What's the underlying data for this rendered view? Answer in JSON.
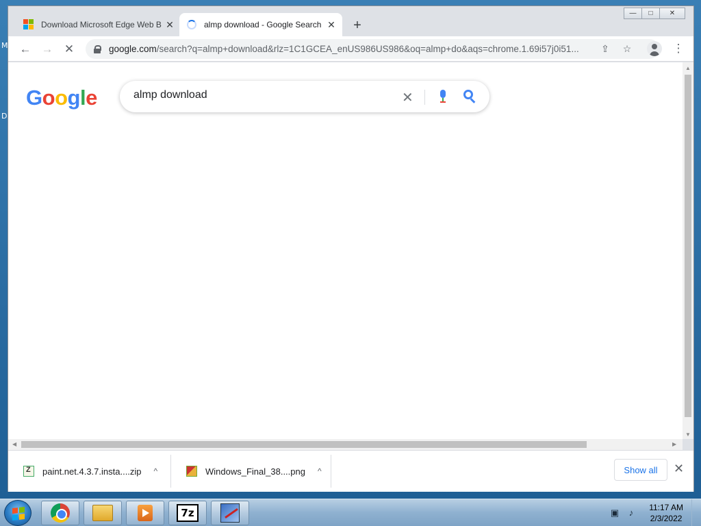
{
  "desktop": {
    "edge_letters": [
      "M",
      "D"
    ]
  },
  "window": {
    "controls": {
      "minimize": "—",
      "maximize": "□",
      "close": "✕"
    }
  },
  "tabs": [
    {
      "title": "Download Microsoft Edge Web B",
      "icon": "microsoft-logo-icon",
      "close": "✕"
    },
    {
      "title": "almp download - Google Search",
      "icon": "loading-spinner-icon",
      "close": "✕"
    }
  ],
  "toolbar": {
    "back": "←",
    "forward": "→",
    "stop": "✕",
    "url_host": "google.com",
    "url_path": "/search?q=almp+download&rlz=1C1GCEA_enUS986US986&oq=almp+do&aqs=chrome.1.69i57j0i51...",
    "share_icon": "share-icon",
    "star": "☆",
    "menu": "⋮"
  },
  "search": {
    "logo": [
      "G",
      "o",
      "o",
      "g",
      "l",
      "e"
    ],
    "logo_colors": [
      "#4285f4",
      "#ea4335",
      "#fbbc05",
      "#4285f4",
      "#34a853",
      "#ea4335"
    ],
    "query": "almp download",
    "clear": "✕"
  },
  "downloads": {
    "items": [
      {
        "name": "paint.net.4.3.7.insta....zip",
        "icon": "zip-file-icon",
        "caret": "^"
      },
      {
        "name": "Windows_Final_38....png",
        "icon": "png-file-icon",
        "caret": "^"
      }
    ],
    "show_all": "Show all",
    "close": "✕"
  },
  "taskbar": {
    "apps": [
      "chrome-icon",
      "file-explorer-icon",
      "media-player-icon",
      "7zip-icon",
      "app-icon"
    ],
    "sevenzip_label": "7z",
    "clock_time": "11:17 AM",
    "clock_date": "2/3/2022"
  }
}
